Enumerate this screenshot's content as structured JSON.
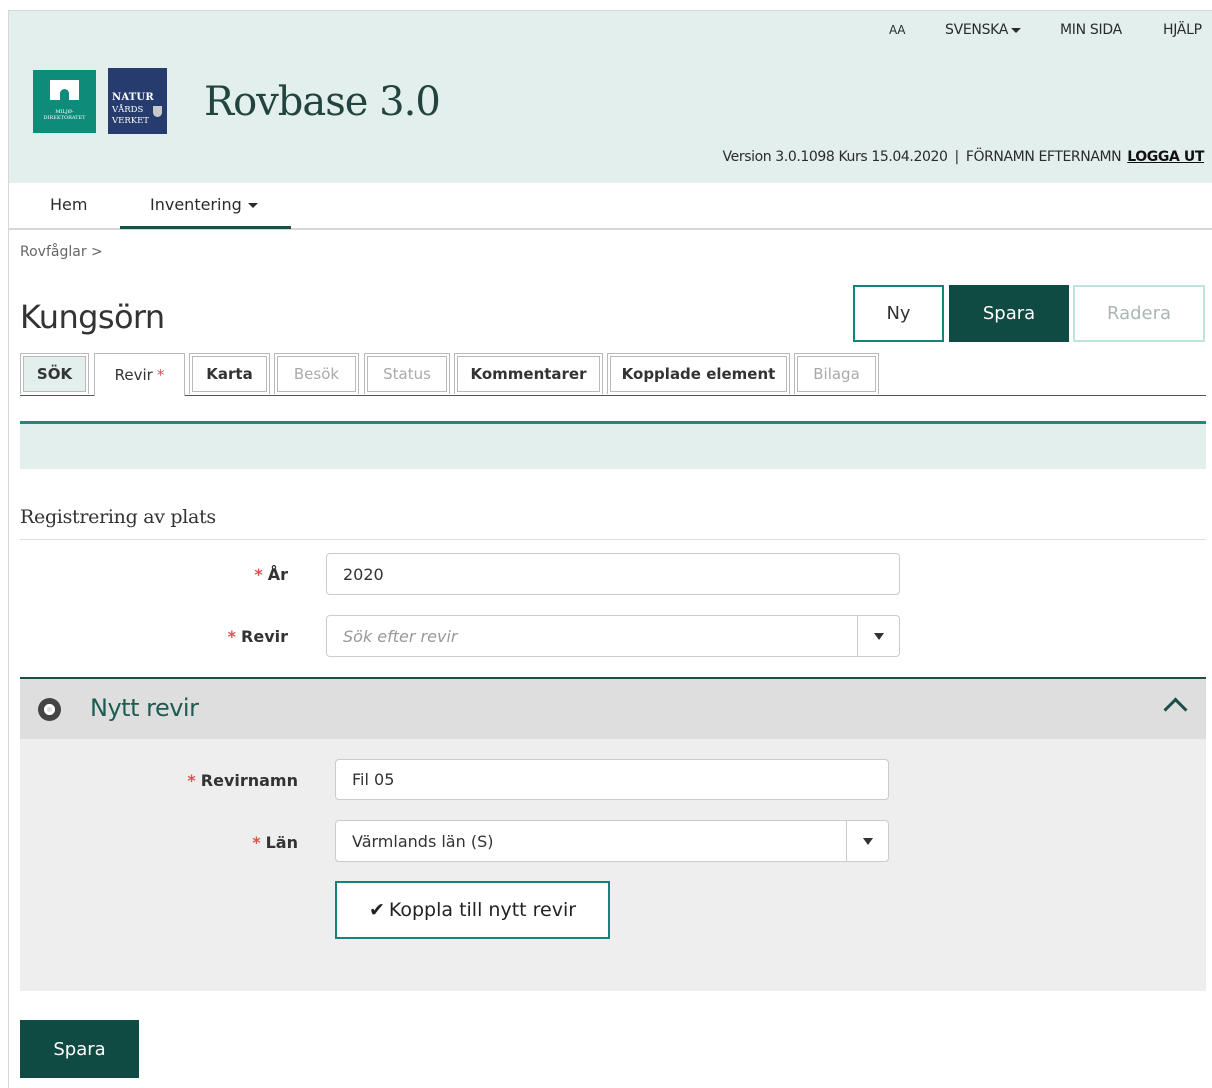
{
  "header": {
    "text_size": "AA",
    "language": "SVENSKA",
    "my_page": "MIN SIDA",
    "help": "HJÄLP",
    "logo_left_lines": [
      "MILJØ-",
      "DIREKTORATET"
    ],
    "logo_right_lines": [
      "NATUR",
      "VÅRDS",
      "VERKET"
    ],
    "site_title": "Rovbase 3.0",
    "version": "Version 3.0.1098 Kurs 15.04.2020",
    "separator": "|",
    "user": "FÖRNAMN EFTERNAMN",
    "logout": "LOGGA UT"
  },
  "nav": {
    "home": "Hem",
    "inventory": "Inventering"
  },
  "breadcrumb": "Rovfåglar >",
  "page_title": "Kungsörn",
  "actions": {
    "new": "Ny",
    "save": "Spara",
    "delete": "Radera"
  },
  "tabs": [
    {
      "label": "SÖK",
      "state": "normal"
    },
    {
      "label": "Revir",
      "state": "active",
      "required": "*"
    },
    {
      "label": "Karta",
      "state": "normal"
    },
    {
      "label": "Besök",
      "state": "disabled"
    },
    {
      "label": "Status",
      "state": "disabled"
    },
    {
      "label": "Kommentarer",
      "state": "normal"
    },
    {
      "label": "Kopplade element",
      "state": "normal"
    },
    {
      "label": "Bilaga",
      "state": "disabled"
    }
  ],
  "form": {
    "section_title": "Registrering av plats",
    "required_marker": "*",
    "year_label": "År",
    "year_value": "2020",
    "revir_label": "Revir",
    "revir_placeholder": "Sök efter revir"
  },
  "panel": {
    "title": "Nytt revir",
    "name_label": "Revirnamn",
    "name_value": "Fil 05",
    "county_label": "Län",
    "county_value": "Värmlands län (S)",
    "connect_check": "✔",
    "connect_button": "Koppla till nytt revir"
  },
  "footer": {
    "save": "Spara"
  },
  "colors": {
    "header_bg": "#e3efec",
    "primary_dark": "#0f4a43",
    "accent_teal": "#12857a",
    "required_red": "#d9534f"
  }
}
